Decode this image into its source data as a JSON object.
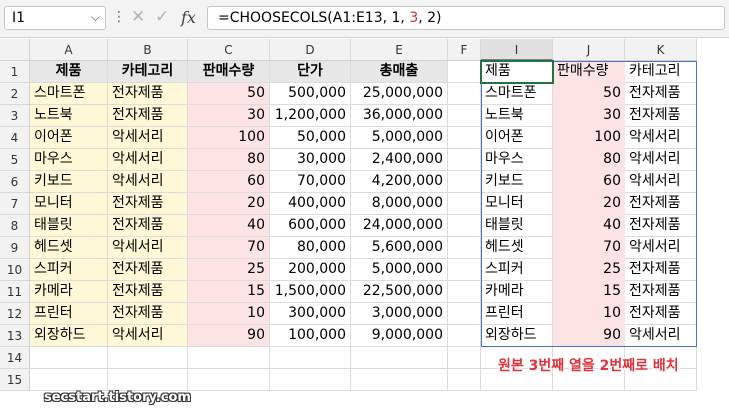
{
  "formula_bar": {
    "name_box": "I1",
    "formula_before": "=CHOOSECOLS(A1:E13, 1, ",
    "formula_highlight": "3",
    "formula_after": ", 2)",
    "icons": [
      "cancel-icon",
      "enter-check-icon",
      "insert-function-icon"
    ]
  },
  "columns": [
    "A",
    "B",
    "C",
    "D",
    "E",
    "F",
    "I",
    "J",
    "K"
  ],
  "rows": [
    "1",
    "2",
    "3",
    "4",
    "5",
    "6",
    "7",
    "8",
    "9",
    "10",
    "11",
    "12",
    "13",
    "14",
    "15"
  ],
  "source_table": {
    "headers": [
      "제품",
      "카테고리",
      "판매수량",
      "단가",
      "총매출"
    ],
    "rows": [
      [
        "스마트폰",
        "전자제품",
        "50",
        "500,000",
        "25,000,000"
      ],
      [
        "노트북",
        "전자제품",
        "30",
        "1,200,000",
        "36,000,000"
      ],
      [
        "이어폰",
        "악세서리",
        "100",
        "50,000",
        "5,000,000"
      ],
      [
        "마우스",
        "악세서리",
        "80",
        "30,000",
        "2,400,000"
      ],
      [
        "키보드",
        "악세서리",
        "60",
        "70,000",
        "4,200,000"
      ],
      [
        "모니터",
        "전자제품",
        "20",
        "400,000",
        "8,000,000"
      ],
      [
        "태블릿",
        "전자제품",
        "40",
        "600,000",
        "24,000,000"
      ],
      [
        "헤드셋",
        "악세서리",
        "70",
        "80,000",
        "5,600,000"
      ],
      [
        "스피커",
        "전자제품",
        "25",
        "200,000",
        "5,000,000"
      ],
      [
        "카메라",
        "전자제품",
        "15",
        "1,500,000",
        "22,500,000"
      ],
      [
        "프린터",
        "전자제품",
        "10",
        "300,000",
        "3,000,000"
      ],
      [
        "외장하드",
        "악세서리",
        "90",
        "100,000",
        "9,000,000"
      ]
    ]
  },
  "result_table": {
    "headers": [
      "제품",
      "판매수량",
      "카테고리"
    ],
    "rows": [
      [
        "스마트폰",
        "50",
        "전자제품"
      ],
      [
        "노트북",
        "30",
        "전자제품"
      ],
      [
        "이어폰",
        "100",
        "악세서리"
      ],
      [
        "마우스",
        "80",
        "악세서리"
      ],
      [
        "키보드",
        "60",
        "악세서리"
      ],
      [
        "모니터",
        "20",
        "전자제품"
      ],
      [
        "태블릿",
        "40",
        "전자제품"
      ],
      [
        "헤드셋",
        "70",
        "악세서리"
      ],
      [
        "스피커",
        "25",
        "전자제품"
      ],
      [
        "카메라",
        "15",
        "전자제품"
      ],
      [
        "프린터",
        "10",
        "전자제품"
      ],
      [
        "외장하드",
        "90",
        "악세서리"
      ]
    ]
  },
  "caption": "원본 3번째 열을 2번째로 배치",
  "watermark": "secstart.tistory.com",
  "colors": {
    "yellow_fill": "#fff8d6",
    "pink_fill": "#fde4e4",
    "header_gray": "#e7e7e7",
    "spill_border": "#4472c4",
    "active_cell": "#217346",
    "caption_red": "#e0323c"
  }
}
